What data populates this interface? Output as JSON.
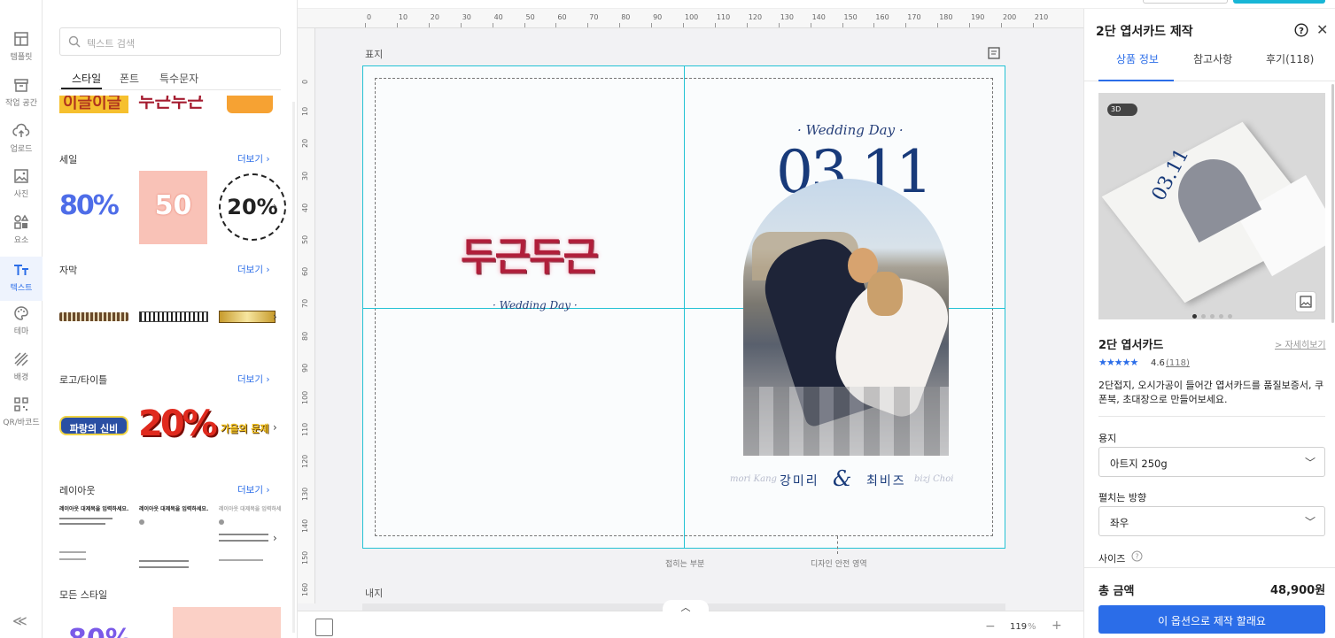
{
  "rail": {
    "items": [
      {
        "label": "템플릿",
        "icon": "template-icon"
      },
      {
        "label": "작업 공간",
        "icon": "workspace-icon"
      },
      {
        "label": "업로드",
        "icon": "upload-icon"
      },
      {
        "label": "사진",
        "icon": "photo-icon"
      },
      {
        "label": "요소",
        "icon": "elements-icon"
      },
      {
        "label": "텍스트",
        "icon": "text-icon",
        "active": true
      },
      {
        "label": "테마",
        "icon": "theme-icon"
      },
      {
        "label": "배경",
        "icon": "background-icon"
      },
      {
        "label": "QR/바코드",
        "icon": "qr-icon"
      }
    ],
    "collapse": "≪"
  },
  "panel": {
    "search_placeholder": "텍스트 검색",
    "tabs": [
      "스타일",
      "폰트",
      "특수문자"
    ],
    "more_label": "더보기",
    "sections": [
      {
        "title": "세일",
        "thumbs": [
          "80%",
          "50",
          "20%"
        ]
      },
      {
        "title": "자막"
      },
      {
        "title": "로고/타이틀",
        "thumbs": [
          "파랑의 신비",
          "20%",
          "가을의 문제"
        ]
      },
      {
        "title": "레이아웃",
        "layout_heading": "레이아웃 대제목을 입력하세요."
      },
      {
        "title": "모든 스타일"
      }
    ]
  },
  "canvas": {
    "cover_label": "표지",
    "inner_label": "내지",
    "fold_label": "접히는 부분",
    "safe_label": "디자인 안전 영역",
    "left_title": "두근두근",
    "left_sub": "· Wedding Day ·",
    "right_sub": "· Wedding Day ·",
    "date": "03.11",
    "groom_en": "mori Kang",
    "groom": "강미리",
    "amp": "&",
    "bride": "최비즈",
    "bride_en": "bizj Choi",
    "zoom": "119",
    "zoom_unit": "%",
    "ruler_top": [
      "0",
      "10",
      "20",
      "30",
      "40",
      "50",
      "60",
      "70",
      "80",
      "90",
      "100",
      "110",
      "120",
      "130",
      "140",
      "150",
      "160",
      "170",
      "180",
      "190",
      "200",
      "210"
    ],
    "ruler_left": [
      "0",
      "10",
      "20",
      "30",
      "40",
      "50",
      "60",
      "70",
      "80",
      "90",
      "100",
      "110",
      "120",
      "130",
      "140",
      "150",
      "160"
    ]
  },
  "right": {
    "title": "2단 엽서카드 제작",
    "tabs": [
      "상품 정보",
      "참고사항",
      "후기(118)"
    ],
    "badge_3d": "3D",
    "img_date": "03.11",
    "product_name": "2단 엽서카드",
    "detail_link": "> 자세히보기",
    "rating": "4.6",
    "review_count": "(118)",
    "description": "2단접지, 오시가공이 들어간 엽서카드를 품질보증서, 쿠폰북, 초대장으로 만들어보세요.",
    "paper_label": "용지",
    "paper_value": "아트지 250g",
    "fold_label": "펼치는 방향",
    "fold_value": "좌우",
    "size_label": "사이즈",
    "total_label": "총 금액",
    "total_value": "48,900원",
    "order_button": "이 옵션으로 제작 할래요",
    "accent": "#2b6de8"
  }
}
